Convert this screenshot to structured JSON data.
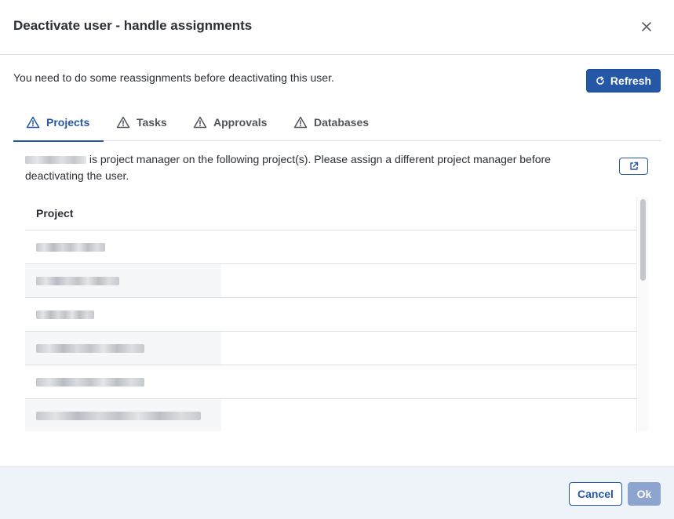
{
  "dialog": {
    "title": "Deactivate user - handle assignments",
    "close_icon": "close-icon"
  },
  "intro": {
    "text": "You need to do some reassignments before deactivating this user."
  },
  "refresh_button": {
    "label": "Refresh",
    "icon": "refresh-icon"
  },
  "tabs": [
    {
      "label": "Projects",
      "icon": "warning-icon",
      "active": true
    },
    {
      "label": "Tasks",
      "icon": "warning-icon",
      "active": false
    },
    {
      "label": "Approvals",
      "icon": "warning-icon",
      "active": false
    },
    {
      "label": "Databases",
      "icon": "warning-icon",
      "active": false
    }
  ],
  "description": {
    "text": "is project manager on the following project(s). Please assign a different project manager before deactivating the user."
  },
  "open_button": {
    "icon": "external-link-icon"
  },
  "table": {
    "header": "Project"
  },
  "footer": {
    "cancel_label": "Cancel",
    "ok_label": "Ok"
  },
  "colors": {
    "primary": "#2557a7",
    "primary_disabled": "#8ca4cf",
    "footer_bg": "#eef3f9",
    "border": "#dcdfe4"
  }
}
